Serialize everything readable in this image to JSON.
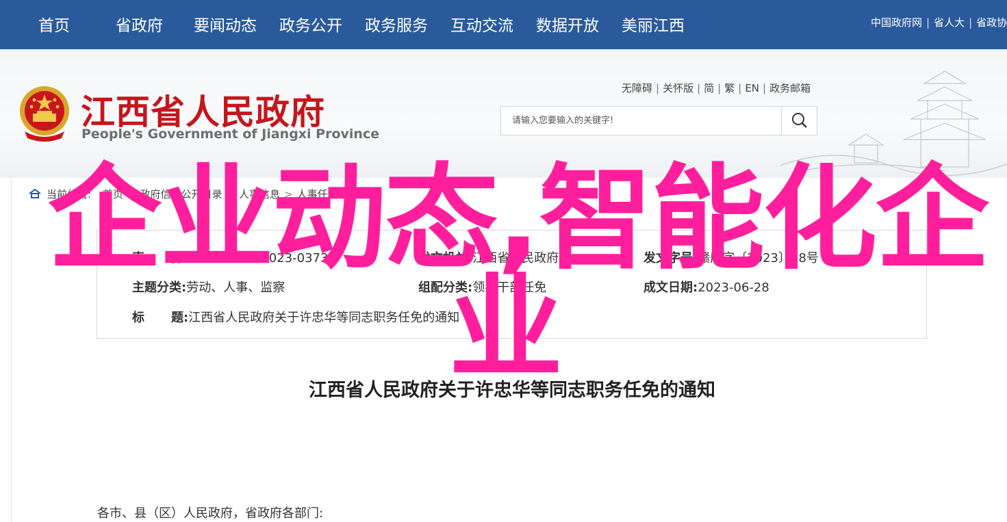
{
  "topnav": {
    "items": [
      "首页",
      "省政府",
      "要闻动态",
      "政务公开",
      "政务服务",
      "互动交流",
      "数据开放",
      "美丽江西"
    ],
    "links": [
      "中国政府网",
      "省人大",
      "省政协"
    ]
  },
  "header": {
    "title": "江西省人民政府",
    "subtitle": "People's Government of Jiangxi Province",
    "util_links": [
      "无障碍",
      "关怀版",
      "简",
      "繁",
      "EN",
      "政务邮箱"
    ],
    "search_placeholder": "请输入您要输入的关键字!"
  },
  "breadcrumb": {
    "prefix": "当前位置:",
    "items": [
      "首页",
      "政府信息公开目录",
      "人事信息",
      "人事任免"
    ]
  },
  "info": {
    "index_label": "索　　引:",
    "index_value": "014500810/2023-03733",
    "issuer_label": "发文机关:",
    "issuer_value": "江西省人民政府",
    "docno_label": "发文字号:",
    "docno_value": "赣府字〔2023〕38号",
    "topic_label": "主题分类:",
    "topic_value": "劳动、人事、监察",
    "category_label": "组配分类:",
    "category_value": "领导干部任免",
    "date_label": "成文日期:",
    "date_value": "2023-06-28",
    "title_label_a": "标",
    "title_label_b": "题:",
    "title_value": "江西省人民政府关于许忠华等同志职务任免的通知"
  },
  "article": {
    "title": "江西省人民政府关于许忠华等同志职务任免的通知",
    "salutation": "各市、县（区）人民政府，省政府各部门:"
  },
  "overlay": {
    "line1": "企业动态,智能化企",
    "line2": "业",
    "color": "#ff1f9d"
  },
  "colors": {
    "nav_bg": "#2a5a9c",
    "title_red": "#c4161c"
  }
}
